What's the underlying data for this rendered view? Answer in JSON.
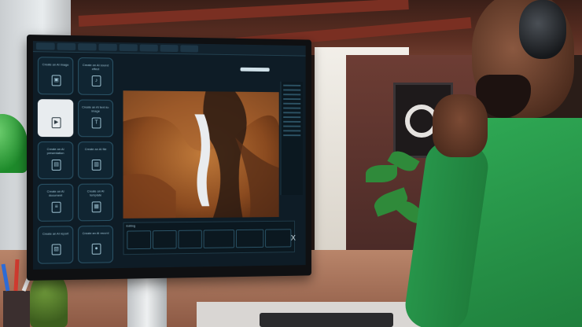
{
  "scene": {
    "ui": {
      "tiles": [
        {
          "label": "Create an AI image",
          "icon": "image-icon"
        },
        {
          "label": "Create an AI sound effect",
          "icon": "sound-icon"
        },
        {
          "label": "",
          "icon": "play-icon",
          "selected": true
        },
        {
          "label": "Create an AI text-to-image",
          "icon": "text-icon"
        },
        {
          "label": "Create an AI presentation",
          "icon": "slides-icon"
        },
        {
          "label": "Create an AI file",
          "icon": "file-icon"
        },
        {
          "label": "Create an AI document",
          "icon": "doc-icon"
        },
        {
          "label": "Create an AI template",
          "icon": "template-icon"
        },
        {
          "label": "Create an AI report",
          "icon": "report-icon"
        },
        {
          "label": "Create an AI record",
          "icon": "record-icon"
        }
      ],
      "timeline_title": "Editing",
      "close_glyph": "X"
    }
  }
}
